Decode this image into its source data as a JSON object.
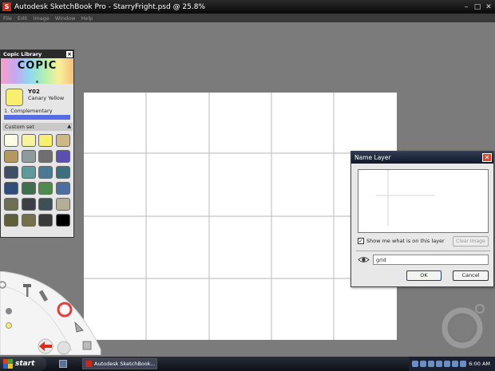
{
  "window": {
    "title": "Autodesk SketchBook Pro - StarryFright.psd @ 25.8%",
    "controls": [
      "minimize",
      "maximize",
      "close"
    ]
  },
  "menu": [
    "File",
    "Edit",
    "Image",
    "Window",
    "Help"
  ],
  "copic_library": {
    "title": "Copic Library",
    "logo_text": "COPIC",
    "selected_code": "Y02",
    "selected_name": "Canary Yellow",
    "selected_color": "#f8ee70",
    "complementary_label": "1. Complementary",
    "complementary_color": "#5a6ae0",
    "custom_set_label": "Custom set",
    "swatches": [
      "#fbfbe6",
      "#f6f4a0",
      "#f8ee70",
      "#cdb88a",
      "#b39860",
      "#8f9a9a",
      "#6f6f72",
      "#5c4fb0",
      "#3f4f66",
      "#5f9a9a",
      "#4c7a92",
      "#3f6f7f",
      "#2f4f7a",
      "#3f6f4f",
      "#4f8a4f",
      "#4c6fa0",
      "#6f6f55",
      "#3f3f48",
      "#3f4f56",
      "#b4ae98",
      "#5f5f3a",
      "#74704c",
      "#3a3a3a",
      "#000000"
    ]
  },
  "dialog": {
    "title": "Name Layer",
    "show_label": "Show me what is on this layer",
    "show_checked": "✓",
    "clear_label": "Clear Image",
    "layer_name": "grid",
    "ok_label": "OK",
    "cancel_label": "Cancel"
  },
  "taskbar": {
    "start_label": "start",
    "task_label": "Autodesk SketchBook...",
    "time": "6:00 AM"
  }
}
